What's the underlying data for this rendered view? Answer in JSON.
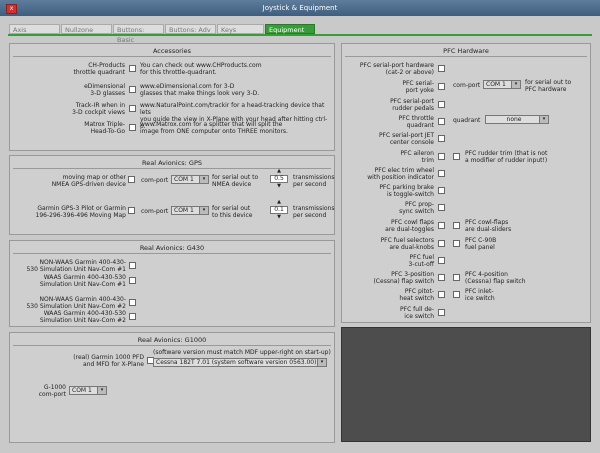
{
  "window": {
    "title": "Joystick & Equipment",
    "close_symbol": "x"
  },
  "tabs": [
    "Axis",
    "Nullzone",
    "Buttons: Basic",
    "Buttons: Adv",
    "Keys",
    "Equipment"
  ],
  "accessories": {
    "title": "Accessories",
    "items": [
      {
        "label_l1": "CH-Products",
        "label_l2": "throttle quadrant",
        "text_l1": "You can check out www.CHProducts.com",
        "text_l2": "for this throttle-quadrant."
      },
      {
        "label_l1": "eDimensional",
        "label_l2": "3-D glasses",
        "text_l1": "www.eDimensional.com for 3-D",
        "text_l2": "glasses that make things look very 3-D."
      },
      {
        "label_l1": "Track-IR when in",
        "label_l2": "3-D cockpit views",
        "text_l1": "www.NaturalPoint.com/trackir for a head-tracking device that lets",
        "text_l2": "you guide the view in X-Plane with your head after hitting ctrl-o."
      },
      {
        "label_l1": "Matrox Triple-",
        "label_l2": "Head-To-Go",
        "text_l1": "www.Matrox.com for a splitter that will split the",
        "text_l2": "image from ONE computer onto THREE monitors."
      }
    ]
  },
  "gps": {
    "title": "Real Avionics: GPS",
    "comport_label": "com-port",
    "rows": [
      {
        "label_l1": "moving map or other",
        "label_l2": "NMEA GPS-driven device",
        "com": "COM 1",
        "purpose_l1": "for serial out to",
        "purpose_l2": "NMEA device",
        "rate": "0.5",
        "rate_l1": "transmissions",
        "rate_l2": "per second"
      },
      {
        "label_l1": "Garmin GPS-3 Pilot or Garmin",
        "label_l2": "196-296-396-496 Moving Map",
        "com": "COM 1",
        "purpose_l1": "for serial out",
        "purpose_l2": "to this device",
        "rate": "0.1",
        "rate_l1": "transmissions",
        "rate_l2": "per second"
      }
    ]
  },
  "g430": {
    "title": "Real Avionics: G430",
    "items": [
      {
        "l1": "NON-WAAS Garmin 400-430-",
        "l2": "530 Simulation Unit Nav-Com #1"
      },
      {
        "l1": "WAAS Garmin 400-430-530",
        "l2": "Simulation Unit Nav-Com #1"
      },
      {
        "l1": "NON-WAAS Garmin 400-430-",
        "l2": "530 Simulation Unit Nav-Com #2"
      },
      {
        "l1": "WAAS Garmin 400-430-530",
        "l2": "Simulation Unit Nav-Com #2"
      }
    ]
  },
  "g1000": {
    "title": "Real Avionics: G1000",
    "pfd_l1": "(real) Garmin 1000 PFD",
    "pfd_l2": "and MFD for X-Plane",
    "note": "(software version must match MDF upper-right on start-up)",
    "version": "Cessna 182T 7.01 (system software version 0563.00)",
    "com_l1": "G-1000",
    "com_l2": "com-port",
    "com": "COM 1"
  },
  "pfc": {
    "title": "PFC Hardware",
    "left": [
      {
        "l1": "PFC serial-port hardware",
        "l2": "(cat-2 or above)"
      },
      {
        "l1": "PFC serial-",
        "l2": "port yoke"
      },
      {
        "l1": "PFC serial-port",
        "l2": "rudder pedals"
      },
      {
        "l1": "PFC throttle",
        "l2": "quadrant"
      },
      {
        "l1": "PFC serial-port JET",
        "l2": "center console"
      },
      {
        "l1": "PFC aileron",
        "l2": "trim"
      },
      {
        "l1": "PFC elec trim wheel",
        "l2": "with position indicator"
      },
      {
        "l1": "PFC parking brake",
        "l2": "is toggle-switch"
      },
      {
        "l1": "PFC prop-",
        "l2": "sync switch"
      },
      {
        "l1": "PFC cowl flaps",
        "l2": "are dual-toggles"
      },
      {
        "l1": "PFC fuel selectors",
        "l2": "are dual-knobs"
      },
      {
        "l1": "PFC fuel",
        "l2": "3-cut-off"
      },
      {
        "l1": "PFC 3-position",
        "l2": "(Cessna) flap switch"
      },
      {
        "l1": "PFC pitot-",
        "l2": "heat switch"
      },
      {
        "l1": "PFC full de-",
        "l2": "ice switch"
      }
    ],
    "yoke_comport": "com-port",
    "yoke_com": "COM 1",
    "yoke_purpose_l1": "for serial out to",
    "yoke_purpose_l2": "PFC hardware",
    "quadrant_label": "quadrant",
    "quadrant_value": "none",
    "right": [
      {
        "l1": "PFC rudder trim (that is not",
        "l2": "a modifier of rudder input!)"
      },
      {
        "l1": "PFC cowl-flaps",
        "l2": "are dual-sliders"
      },
      {
        "l1": "PFC C-90B",
        "l2": "fuel panel"
      },
      {
        "l1": "PFC 4-position",
        "l2": "(Cessna) flap switch"
      },
      {
        "l1": "PFC inlet-",
        "l2": "ice switch"
      }
    ]
  }
}
